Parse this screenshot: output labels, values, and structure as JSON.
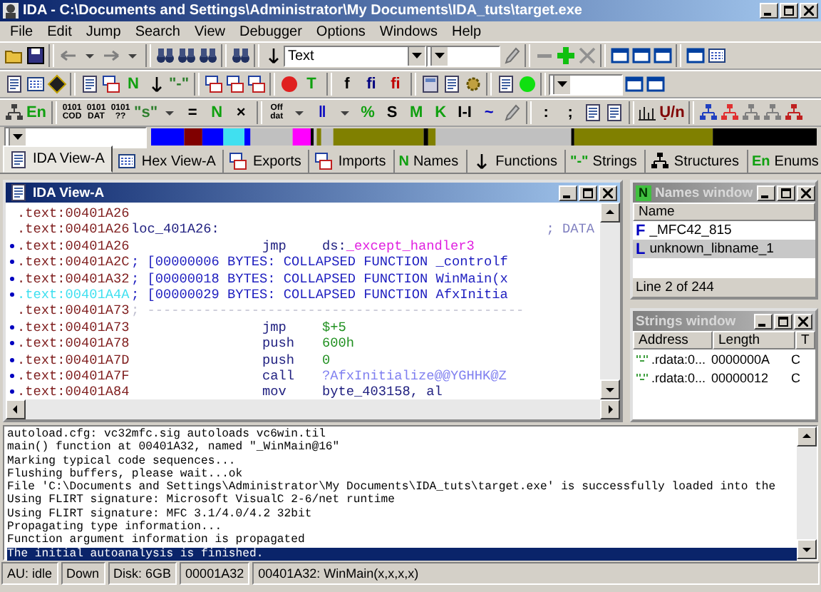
{
  "window": {
    "title": "IDA - C:\\Documents and Settings\\Administrator\\My Documents\\IDA_tuts\\target.exe"
  },
  "menu": [
    "File",
    "Edit",
    "Jump",
    "Search",
    "View",
    "Debugger",
    "Options",
    "Windows",
    "Help"
  ],
  "toolbars": [
    [
      {
        "kind": "folder"
      },
      {
        "kind": "disk"
      },
      {
        "kind": "sep"
      },
      {
        "kind": "arrow-left"
      },
      {
        "kind": "caret"
      },
      {
        "kind": "arrow-right"
      },
      {
        "kind": "caret"
      },
      {
        "kind": "sep"
      },
      {
        "kind": "binoculars"
      },
      {
        "kind": "binoculars"
      },
      {
        "kind": "binoculars"
      },
      {
        "kind": "sep"
      },
      {
        "kind": "binoculars"
      },
      {
        "kind": "sep"
      },
      {
        "kind": "arrow-down"
      },
      {
        "kind": "combo",
        "value": "Text",
        "wide": true
      },
      {
        "kind": "combo",
        "wide": false
      },
      {
        "kind": "pen"
      },
      {
        "kind": "sep"
      },
      {
        "kind": "minus"
      },
      {
        "kind": "plus",
        "color": "#10c010"
      },
      {
        "kind": "cross"
      },
      {
        "kind": "sep"
      },
      {
        "kind": "window"
      },
      {
        "kind": "window"
      },
      {
        "kind": "window"
      },
      {
        "kind": "sep"
      },
      {
        "kind": "window"
      },
      {
        "kind": "grid"
      }
    ],
    [
      {
        "kind": "doc"
      },
      {
        "kind": "grid"
      },
      {
        "kind": "diamond"
      },
      {
        "kind": "sep"
      },
      {
        "kind": "doc"
      },
      {
        "kind": "stack"
      },
      {
        "kind": "glyph",
        "text": "N",
        "color": "#10a010"
      },
      {
        "kind": "arrow-down"
      },
      {
        "kind": "glyph",
        "text": "\"-\"",
        "color": "#308030"
      },
      {
        "kind": "sep"
      },
      {
        "kind": "stack"
      },
      {
        "kind": "stack"
      },
      {
        "kind": "stack"
      },
      {
        "kind": "sep"
      },
      {
        "kind": "circle",
        "color": "#e02020"
      },
      {
        "kind": "glyph",
        "text": "T",
        "color": "#10a010"
      },
      {
        "kind": "sep"
      },
      {
        "kind": "glyph",
        "text": "f",
        "color": "#000000"
      },
      {
        "kind": "glyph",
        "text": "fi",
        "color": "#000080"
      },
      {
        "kind": "glyph",
        "text": "fi",
        "color": "#c00000"
      },
      {
        "kind": "sep"
      },
      {
        "kind": "calculator"
      },
      {
        "kind": "doc"
      },
      {
        "kind": "gear"
      },
      {
        "kind": "sep"
      },
      {
        "kind": "doc"
      },
      {
        "kind": "circle",
        "color": "#10e010"
      },
      {
        "kind": "sep"
      },
      {
        "kind": "combo",
        "wide": false
      },
      {
        "kind": "window"
      },
      {
        "kind": "window"
      }
    ],
    [
      {
        "kind": "tree",
        "color": "#404040"
      },
      {
        "kind": "glyph",
        "text": "En",
        "color": "#10a010"
      },
      {
        "kind": "sep"
      },
      {
        "kind": "stacked",
        "lines": [
          "0101",
          "COD"
        ]
      },
      {
        "kind": "stacked",
        "lines": [
          "0101",
          "DAT"
        ]
      },
      {
        "kind": "stacked",
        "lines": [
          "0101",
          "??"
        ]
      },
      {
        "kind": "glyph",
        "text": "\"s\"",
        "color": "#308030"
      },
      {
        "kind": "caret"
      },
      {
        "kind": "glyph",
        "text": "=",
        "color": "#000000"
      },
      {
        "kind": "glyph",
        "text": "N",
        "color": "#10a010"
      },
      {
        "kind": "glyph",
        "text": "×",
        "color": "#000000"
      },
      {
        "kind": "sep"
      },
      {
        "kind": "stacked",
        "lines": [
          "Off",
          "dat"
        ]
      },
      {
        "kind": "caret"
      },
      {
        "kind": "glyph",
        "text": "‖",
        "color": "#0000c0"
      },
      {
        "kind": "caret"
      },
      {
        "kind": "glyph",
        "text": "%",
        "color": "#10a010"
      },
      {
        "kind": "glyph",
        "text": "S",
        "color": "#000000"
      },
      {
        "kind": "glyph",
        "text": "M",
        "color": "#10a010"
      },
      {
        "kind": "glyph",
        "text": "K",
        "color": "#10a010"
      },
      {
        "kind": "glyph",
        "text": "I-I",
        "color": "#000000"
      },
      {
        "kind": "glyph",
        "text": "~",
        "color": "#0000c0"
      },
      {
        "kind": "pen"
      },
      {
        "kind": "sep"
      },
      {
        "kind": "glyph",
        "text": ":",
        "color": "#000000"
      },
      {
        "kind": "glyph",
        "text": ";",
        "color": "#000000"
      },
      {
        "kind": "doc"
      },
      {
        "kind": "doc"
      },
      {
        "kind": "sep"
      },
      {
        "kind": "bars"
      },
      {
        "kind": "glyph",
        "text": "Ụ/n",
        "color": "#800000"
      },
      {
        "kind": "sep"
      },
      {
        "kind": "tree",
        "color": "#2040c0"
      },
      {
        "kind": "tree",
        "color": "#e03030"
      },
      {
        "kind": "tree",
        "color": "#808080"
      },
      {
        "kind": "tree",
        "color": "#808080"
      },
      {
        "kind": "tree",
        "color": "#c02020"
      }
    ]
  ],
  "tabs": [
    {
      "label": "IDA View-A",
      "kind": "doc",
      "selected": true
    },
    {
      "label": "Hex View-A",
      "kind": "grid",
      "selected": false
    },
    {
      "label": "Exports",
      "kind": "stack",
      "selected": false
    },
    {
      "label": "Imports",
      "kind": "stack",
      "selected": false
    },
    {
      "label": "Names",
      "kind": "glyph",
      "icon_text": "N",
      "selected": false
    },
    {
      "label": "Functions",
      "kind": "arrow-down",
      "selected": false
    },
    {
      "label": "Strings",
      "kind": "glyph",
      "icon_text": "\"-\"",
      "selected": false
    },
    {
      "label": "Structures",
      "kind": "tree",
      "selected": false
    },
    {
      "label": "Enums",
      "kind": "glyph",
      "icon_text": "En",
      "selected": false
    }
  ],
  "ida_view": {
    "title": "IDA View-A",
    "lines": [
      {
        "address": ".text:00401A26",
        "bullet": false,
        "current": false
      },
      {
        "address": ".text:00401A26",
        "bullet": false,
        "current": false,
        "parts": [
          {
            "kind": "label",
            "text": "loc_401A26:"
          },
          {
            "kind": "comment",
            "text": "; DATA"
          }
        ]
      },
      {
        "address": ".text:00401A26",
        "bullet": true,
        "current": false,
        "parts": [
          {
            "kind": "mnemonic",
            "text": "jmp"
          },
          {
            "kind": "operand",
            "text": "ds:"
          },
          {
            "kind": "import",
            "text": "_except_handler3"
          }
        ]
      },
      {
        "address": ".text:00401A2C",
        "bullet": true,
        "current": false,
        "parts": [
          {
            "kind": "collapsed",
            "text": "; [00000006 BYTES: COLLAPSED FUNCTION _controlf"
          }
        ]
      },
      {
        "address": ".text:00401A32",
        "bullet": true,
        "current": false,
        "parts": [
          {
            "kind": "collapsed",
            "text": "; [00000018 BYTES: COLLAPSED FUNCTION WinMain(x"
          }
        ]
      },
      {
        "address": ".text:00401A4A",
        "bullet": true,
        "current": true,
        "parts": [
          {
            "kind": "collapsed",
            "text": "; [00000029 BYTES: COLLAPSED FUNCTION AfxInitia"
          }
        ]
      },
      {
        "address": ".text:00401A73",
        "bullet": false,
        "current": false,
        "parts": [
          {
            "kind": "separator",
            "text": "; -----------------------------------------------"
          }
        ]
      },
      {
        "address": ".text:00401A73",
        "bullet": true,
        "current": false,
        "parts": [
          {
            "kind": "mnemonic",
            "text": "jmp"
          },
          {
            "kind": "number",
            "text": "$+5"
          }
        ]
      },
      {
        "address": ".text:00401A78",
        "bullet": true,
        "current": false,
        "parts": [
          {
            "kind": "mnemonic",
            "text": "push"
          },
          {
            "kind": "number",
            "text": "600h"
          }
        ]
      },
      {
        "address": ".text:00401A7D",
        "bullet": true,
        "current": false,
        "parts": [
          {
            "kind": "mnemonic",
            "text": "push"
          },
          {
            "kind": "number",
            "text": "0"
          }
        ]
      },
      {
        "address": ".text:00401A7F",
        "bullet": true,
        "current": false,
        "parts": [
          {
            "kind": "mnemonic",
            "text": "call"
          },
          {
            "kind": "extern",
            "text": "?AfxInitialize@@YGHHK@Z"
          }
        ]
      },
      {
        "address": ".text:00401A84",
        "bullet": true,
        "current": false,
        "parts": [
          {
            "kind": "mnemonic",
            "text": "mov"
          },
          {
            "kind": "operand",
            "text": "byte_403158, al"
          }
        ]
      }
    ]
  },
  "names_window": {
    "icon_text": "N",
    "title": "Names window",
    "column": "Name",
    "rows": [
      {
        "letter": "F",
        "color": "#0000c0",
        "name": "_MFC42_815",
        "selected": false
      },
      {
        "letter": "L",
        "color": "#0000c0",
        "name": "unknown_libname_1",
        "selected": true
      }
    ],
    "status": "Line 2 of 244"
  },
  "strings_window": {
    "title": "Strings window",
    "columns": [
      "Address",
      "Length",
      "T"
    ],
    "rows": [
      {
        "address": ".rdata:0...",
        "length": "0000000A",
        "type": "C"
      },
      {
        "address": ".rdata:0...",
        "length": "00000012",
        "type": "C"
      }
    ]
  },
  "output": {
    "lines": [
      {
        "text": "autoload.cfg: vc32mfc.sig autoloads vc6win.til",
        "selected": false
      },
      {
        "text": "main() function at 00401A32, named \"_WinMain@16\"",
        "selected": false
      },
      {
        "text": "Marking typical code sequences...",
        "selected": false
      },
      {
        "text": "Flushing buffers, please wait...ok",
        "selected": false
      },
      {
        "text": "File 'C:\\Documents and Settings\\Administrator\\My Documents\\IDA_tuts\\target.exe' is successfully loaded into the",
        "selected": false
      },
      {
        "text": "Using FLIRT signature: Microsoft VisualC 2-6/net runtime",
        "selected": false
      },
      {
        "text": "Using FLIRT signature: MFC 3.1/4.0/4.2 32bit",
        "selected": false
      },
      {
        "text": "Propagating type information...",
        "selected": false
      },
      {
        "text": "Function argument information is propagated",
        "selected": false
      },
      {
        "text": "The initial autoanalysis is finished.",
        "selected": true
      }
    ]
  },
  "status_bar": [
    "AU:  idle",
    "Down",
    "Disk: 6GB",
    "00001A32",
    "00401A32: WinMain(x,x,x,x)"
  ]
}
